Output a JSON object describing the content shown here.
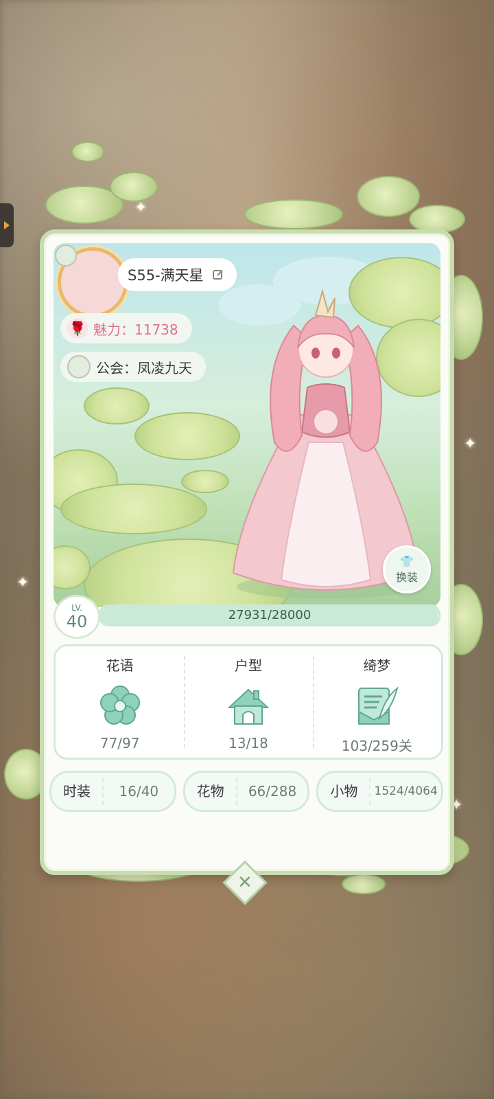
{
  "profile": {
    "name": "S55-满天星",
    "charm": "魅力：11738",
    "guild": "公会：凤凌九天"
  },
  "dress_button": {
    "label": "换装"
  },
  "level": {
    "prefix": "LV.",
    "value": "40"
  },
  "experience": {
    "text": "27931/28000",
    "progress": 0.9975
  },
  "stats": [
    {
      "label": "花语",
      "value": "77/97",
      "icon": "flower-icon"
    },
    {
      "label": "户型",
      "value": "13/18",
      "icon": "house-icon"
    },
    {
      "label": "绮梦",
      "value": "103/259关",
      "icon": "quill-letter-icon"
    }
  ],
  "collections": [
    {
      "label": "时装",
      "value": "16/40"
    },
    {
      "label": "花物",
      "value": "66/288"
    },
    {
      "label": "小物",
      "value": "1524/4064"
    }
  ],
  "colors": {
    "accent_green": "#5d8a7c",
    "charm_pink": "#e0708e",
    "card_border": "#c7dcaf"
  }
}
